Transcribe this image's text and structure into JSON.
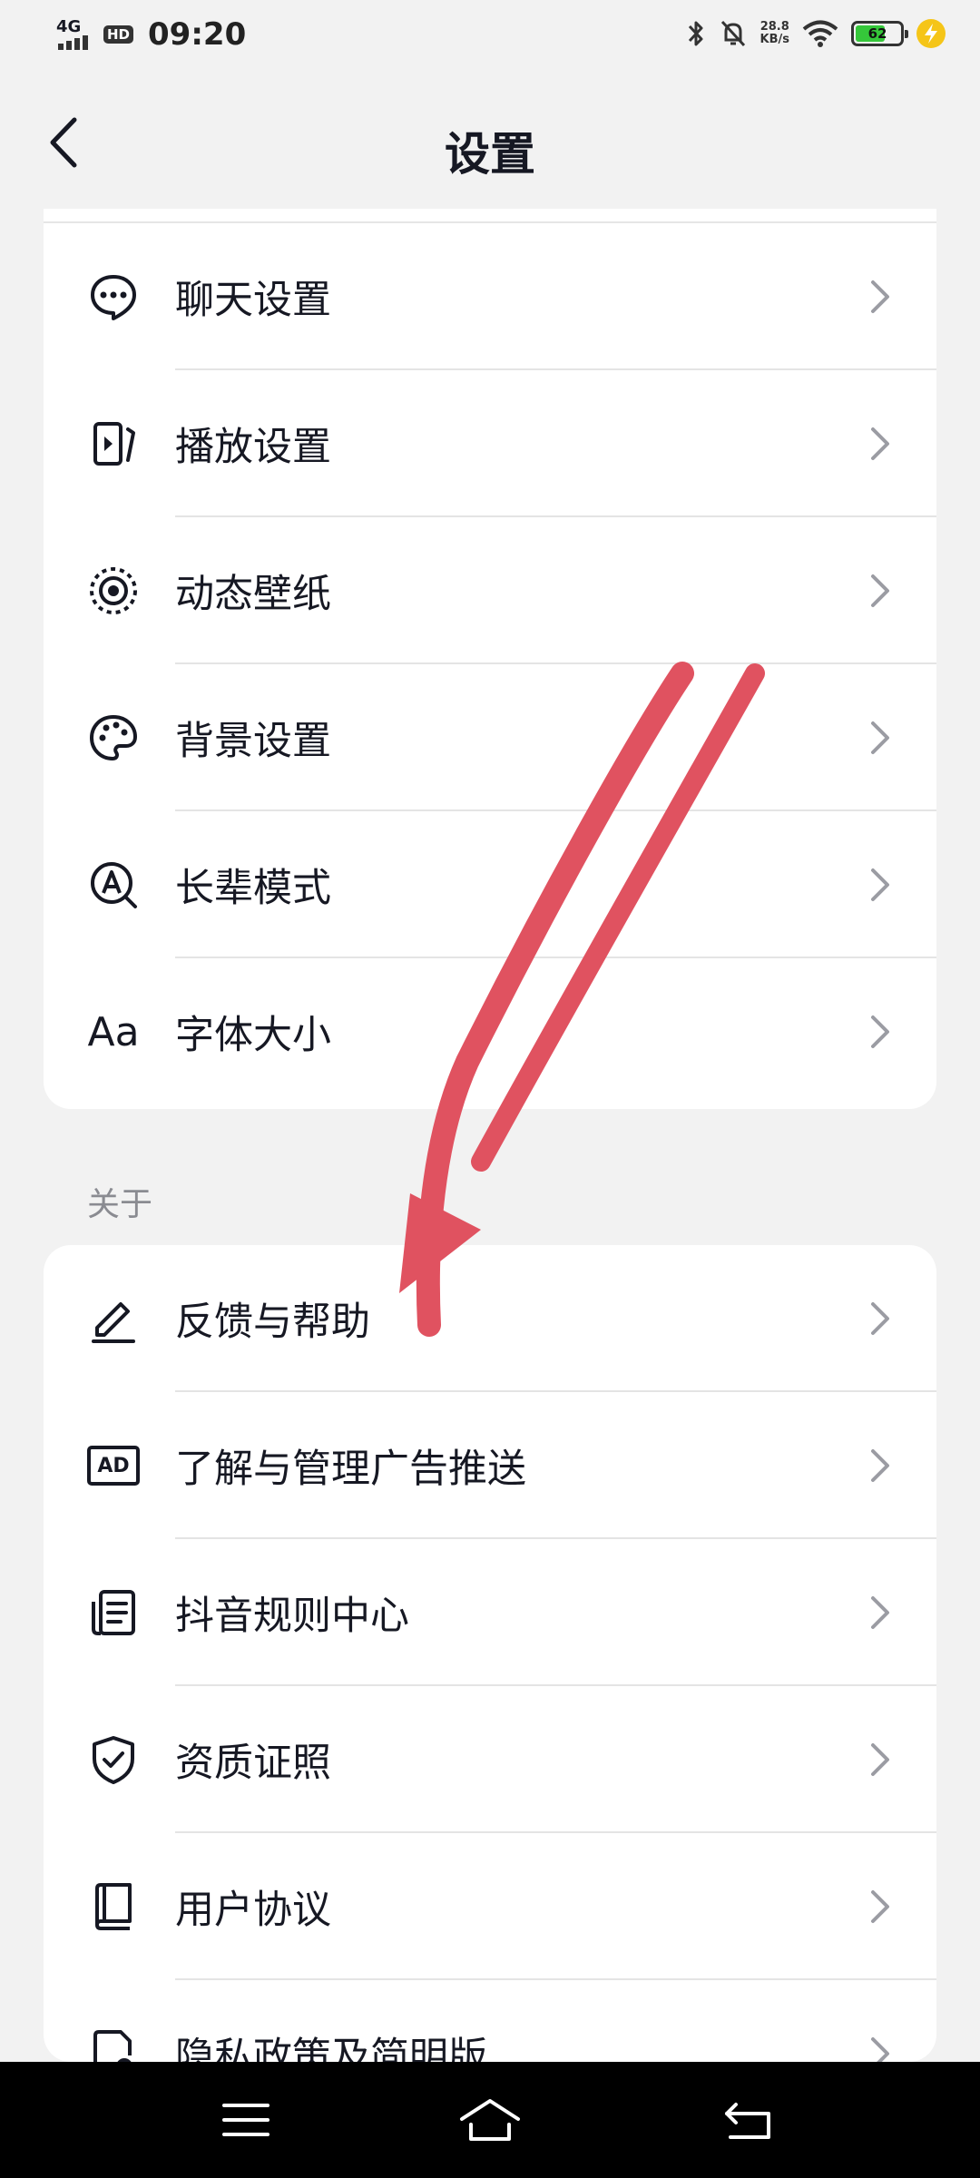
{
  "status_bar": {
    "network": "4G",
    "hd": "HD",
    "time": "09:20",
    "speed_value": "28.8",
    "speed_unit": "KB/s",
    "battery_level": "62"
  },
  "header": {
    "title": "设置"
  },
  "settings_group": {
    "items": [
      {
        "label": "聊天设置",
        "icon": "chat-bubble-icon"
      },
      {
        "label": "播放设置",
        "icon": "play-device-icon"
      },
      {
        "label": "动态壁纸",
        "icon": "live-wallpaper-icon"
      },
      {
        "label": "背景设置",
        "icon": "palette-icon"
      },
      {
        "label": "长辈模式",
        "icon": "elder-mode-icon"
      },
      {
        "label": "字体大小",
        "icon": "font-size-icon",
        "icon_text": "Aa"
      }
    ]
  },
  "about_section": {
    "label": "关于",
    "items": [
      {
        "label": "反馈与帮助",
        "icon": "pencil-icon"
      },
      {
        "label": "了解与管理广告推送",
        "icon": "ad-icon",
        "icon_text": "AD"
      },
      {
        "label": "抖音规则中心",
        "icon": "rules-document-icon"
      },
      {
        "label": "资质证照",
        "icon": "shield-check-icon"
      },
      {
        "label": "用户协议",
        "icon": "book-icon"
      },
      {
        "label": "隐私政策及简明版",
        "icon": "privacy-doc-icon"
      }
    ]
  },
  "colors": {
    "background": "#f2f2f2",
    "card": "#ffffff",
    "text": "#161823",
    "annotation_arrow": "#e05260",
    "battery": "#35c73a"
  }
}
